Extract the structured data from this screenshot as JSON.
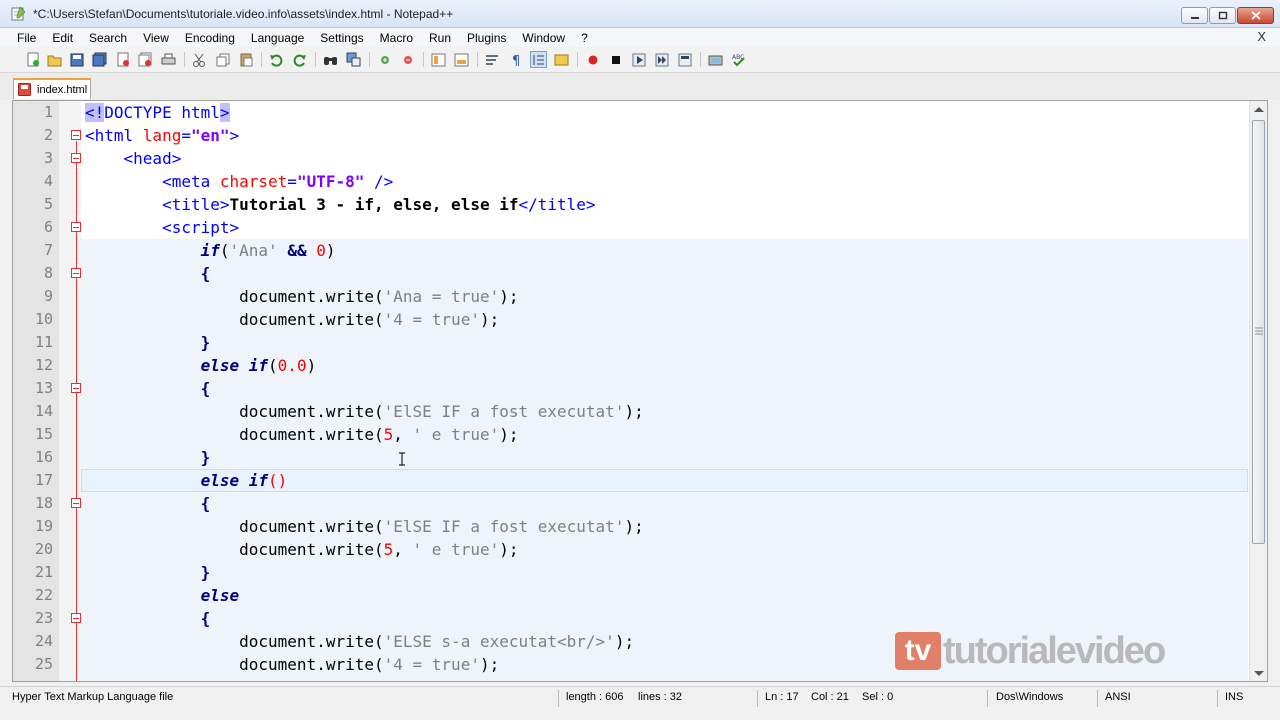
{
  "window": {
    "title": "*C:\\Users\\Stefan\\Documents\\tutoriale.video.info\\assets\\index.html - Notepad++"
  },
  "menu": [
    "File",
    "Edit",
    "Search",
    "View",
    "Encoding",
    "Language",
    "Settings",
    "Macro",
    "Run",
    "Plugins",
    "Window",
    "?"
  ],
  "menu_close": "X",
  "tab": {
    "label": "index.html"
  },
  "editor": {
    "lines": [
      {
        "n": "1",
        "segs": [
          [
            "t-sel t-tag",
            "<!"
          ],
          [
            "t-tag",
            "DOCTYPE html"
          ],
          [
            "t-sel t-tag",
            ">"
          ]
        ]
      },
      {
        "n": "2",
        "segs": [
          [
            "t-tag",
            "<html "
          ],
          [
            "t-attr",
            "lang"
          ],
          [
            "t-tag",
            "="
          ],
          [
            "t-val",
            "\"en\""
          ],
          [
            "t-tag",
            ">"
          ]
        ]
      },
      {
        "n": "3",
        "segs": [
          [
            "",
            "    "
          ],
          [
            "t-tag",
            "<head>"
          ]
        ]
      },
      {
        "n": "4",
        "segs": [
          [
            "",
            "        "
          ],
          [
            "t-tag",
            "<meta "
          ],
          [
            "t-attr",
            "charset"
          ],
          [
            "t-tag",
            "="
          ],
          [
            "t-val",
            "\"UTF-8\""
          ],
          [
            "t-tag",
            " />"
          ]
        ]
      },
      {
        "n": "5",
        "segs": [
          [
            "",
            "        "
          ],
          [
            "t-tag",
            "<title>"
          ],
          [
            "t-bold",
            "Tutorial 3 - if, else, else if"
          ],
          [
            "t-tag",
            "</title>"
          ]
        ]
      },
      {
        "n": "6",
        "segs": [
          [
            "",
            "        "
          ],
          [
            "t-tag",
            "<script>"
          ]
        ]
      },
      {
        "n": "7",
        "segs": [
          [
            "",
            "            "
          ],
          [
            "t-kw",
            "if"
          ],
          [
            "t-fn",
            "("
          ],
          [
            "t-str",
            "'Ana'"
          ],
          [
            "t-fn",
            " "
          ],
          [
            "t-op",
            "&&"
          ],
          [
            "t-fn",
            " "
          ],
          [
            "t-num",
            "0"
          ],
          [
            "t-fn",
            ")"
          ]
        ]
      },
      {
        "n": "8",
        "segs": [
          [
            "",
            "            "
          ],
          [
            "t-op",
            "{"
          ]
        ]
      },
      {
        "n": "9",
        "segs": [
          [
            "",
            "                "
          ],
          [
            "t-fn",
            "document.write("
          ],
          [
            "t-str",
            "'Ana = true'"
          ],
          [
            "t-fn",
            ");"
          ]
        ]
      },
      {
        "n": "10",
        "segs": [
          [
            "",
            "                "
          ],
          [
            "t-fn",
            "document.write("
          ],
          [
            "t-str",
            "'4 = true'"
          ],
          [
            "t-fn",
            ");"
          ]
        ]
      },
      {
        "n": "11",
        "segs": [
          [
            "",
            "            "
          ],
          [
            "t-op",
            "}"
          ]
        ]
      },
      {
        "n": "12",
        "segs": [
          [
            "",
            "            "
          ],
          [
            "t-kw",
            "else if"
          ],
          [
            "t-fn",
            "("
          ],
          [
            "t-num",
            "0.0"
          ],
          [
            "t-fn",
            ")"
          ]
        ]
      },
      {
        "n": "13",
        "segs": [
          [
            "",
            "            "
          ],
          [
            "t-op",
            "{"
          ]
        ]
      },
      {
        "n": "14",
        "segs": [
          [
            "",
            "                "
          ],
          [
            "t-fn",
            "document.write("
          ],
          [
            "t-str",
            "'ElSE IF a fost executat'"
          ],
          [
            "t-fn",
            ");"
          ]
        ]
      },
      {
        "n": "15",
        "segs": [
          [
            "",
            "                "
          ],
          [
            "t-fn",
            "document.write("
          ],
          [
            "t-num",
            "5"
          ],
          [
            "t-fn",
            ", "
          ],
          [
            "t-str",
            "' e true'"
          ],
          [
            "t-fn",
            ");"
          ]
        ]
      },
      {
        "n": "16",
        "segs": [
          [
            "",
            "            "
          ],
          [
            "t-op",
            "}"
          ]
        ]
      },
      {
        "n": "17",
        "segs": [
          [
            "",
            "            "
          ],
          [
            "t-kw",
            "else if"
          ],
          [
            "t-num",
            "()"
          ]
        ]
      },
      {
        "n": "18",
        "segs": [
          [
            "",
            "            "
          ],
          [
            "t-op",
            "{"
          ]
        ]
      },
      {
        "n": "19",
        "segs": [
          [
            "",
            "                "
          ],
          [
            "t-fn",
            "document.write("
          ],
          [
            "t-str",
            "'ElSE IF a fost executat'"
          ],
          [
            "t-fn",
            ");"
          ]
        ]
      },
      {
        "n": "20",
        "segs": [
          [
            "",
            "                "
          ],
          [
            "t-fn",
            "document.write("
          ],
          [
            "t-num",
            "5"
          ],
          [
            "t-fn",
            ", "
          ],
          [
            "t-str",
            "' e true'"
          ],
          [
            "t-fn",
            ");"
          ]
        ]
      },
      {
        "n": "21",
        "segs": [
          [
            "",
            "            "
          ],
          [
            "t-op",
            "}"
          ]
        ]
      },
      {
        "n": "22",
        "segs": [
          [
            "",
            "            "
          ],
          [
            "t-kw",
            "else"
          ]
        ]
      },
      {
        "n": "23",
        "segs": [
          [
            "",
            "            "
          ],
          [
            "t-op",
            "{"
          ]
        ]
      },
      {
        "n": "24",
        "segs": [
          [
            "",
            "                "
          ],
          [
            "t-fn",
            "document.write("
          ],
          [
            "t-str",
            "'ELSE s-a executat<br/>'"
          ],
          [
            "t-fn",
            ");"
          ]
        ]
      },
      {
        "n": "25",
        "segs": [
          [
            "",
            "                "
          ],
          [
            "t-fn",
            "document.write("
          ],
          [
            "t-str",
            "'4 = true'"
          ],
          [
            "t-fn",
            ");"
          ]
        ]
      }
    ],
    "fold_lines": [
      "2",
      "3",
      "6",
      "8",
      "13",
      "18",
      "23"
    ]
  },
  "watermark": {
    "badge": "tv",
    "text": "tutorialevideo"
  },
  "status": {
    "filetype": "Hyper Text Markup Language file",
    "length": "length : 606",
    "lines": "lines : 32",
    "ln": "Ln : 17",
    "col": "Col : 21",
    "sel": "Sel : 0",
    "eol": "Dos\\Windows",
    "encoding": "ANSI",
    "mode": "INS"
  },
  "colors": {
    "tag": "#0000ff",
    "attr": "#ff0000",
    "keyword": "#000080",
    "string": "#808080",
    "fold": "#e23a3a"
  }
}
